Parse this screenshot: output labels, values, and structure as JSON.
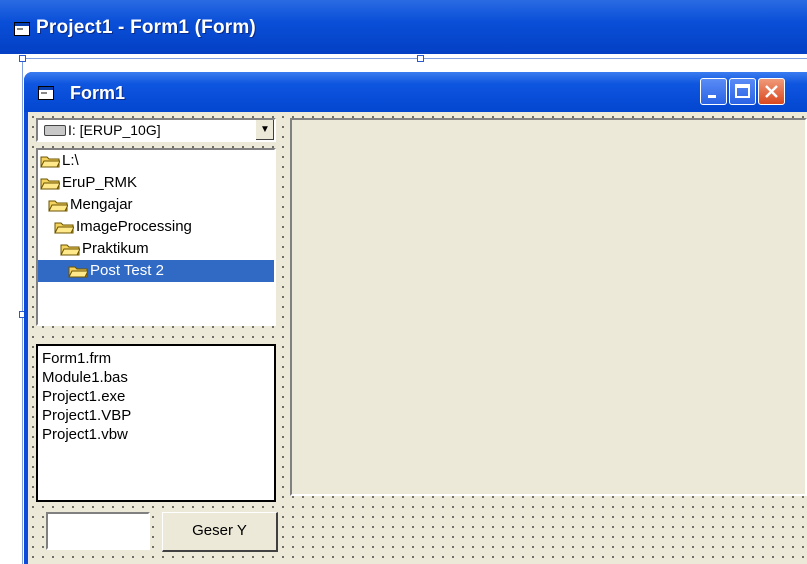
{
  "designer": {
    "title": "Project1 - Form1 (Form)"
  },
  "form": {
    "title": "Form1"
  },
  "drive": {
    "value": "I: [ERUP_10G]"
  },
  "tree": {
    "items": [
      {
        "label": "L:\\"
      },
      {
        "label": "EruP_RMK"
      },
      {
        "label": "Mengajar"
      },
      {
        "label": "ImageProcessing"
      },
      {
        "label": "Praktikum"
      },
      {
        "label": "Post Test 2"
      }
    ]
  },
  "files": {
    "items": [
      "Form1.frm",
      "Module1.bas",
      "Project1.exe",
      "Project1.VBP",
      "Project1.vbw"
    ]
  },
  "textbox": {
    "value": ""
  },
  "button": {
    "label": "Geser Y"
  },
  "colors": {
    "titlebar": "#0a4fd8",
    "selection": "#316ac5",
    "face": "#ece9d8"
  }
}
